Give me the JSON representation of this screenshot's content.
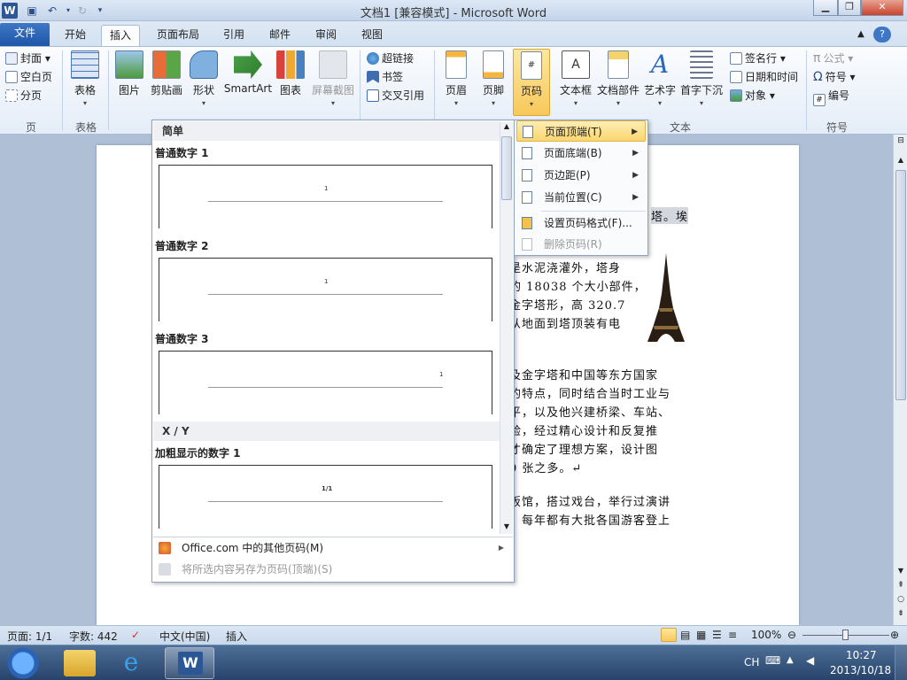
{
  "window": {
    "title": "文档1 [兼容模式] - Microsoft Word"
  },
  "quick_access": {
    "word_icon": "W"
  },
  "menu": {
    "tabs": [
      {
        "label": "文件"
      },
      {
        "label": "开始"
      },
      {
        "label": "插入"
      },
      {
        "label": "页面布局"
      },
      {
        "label": "引用"
      },
      {
        "label": "邮件"
      },
      {
        "label": "审阅"
      },
      {
        "label": "视图"
      }
    ],
    "active_tab": "插入"
  },
  "ribbon": {
    "pages_group": {
      "label": "页",
      "cover": "封面",
      "blank_page": "空白页",
      "page_break": "分页"
    },
    "tables_group": {
      "label": "表格",
      "table": "表格"
    },
    "illustrations": {
      "picture": "图片",
      "clipart": "剪贴画",
      "shapes": "形状",
      "smartart": "SmartArt",
      "chart": "图表",
      "screenshot": "屏幕截图"
    },
    "links_group": {
      "hyperlink": "超链接",
      "bookmark": "书签",
      "cross_reference": "交叉引用"
    },
    "header_footer": {
      "header": "页眉",
      "footer": "页脚",
      "page_number": "页码"
    },
    "text_group": {
      "label": "文本",
      "textbox": "文本框",
      "quick_parts": "文档部件",
      "wordart": "艺术字",
      "dropcap": "首字下沉",
      "signature": "签名行",
      "datetime": "日期和时间",
      "object": "对象"
    },
    "symbols_group": {
      "label": "符号",
      "equation": "公式",
      "symbol": "符号",
      "number": "编号"
    }
  },
  "gallery": {
    "section_simple": "简单",
    "items": [
      {
        "label": "普通数字 1",
        "sample": "1"
      },
      {
        "label": "普通数字 2",
        "sample": "1"
      },
      {
        "label": "普通数字 3",
        "sample": "1"
      }
    ],
    "section_xy": "X / Y",
    "bold_item": {
      "label": "加粗显示的数字 1",
      "sample": "1/1"
    },
    "footer_more": "Office.com 中的其他页码(M)",
    "footer_save": "将所选内容另存为页码(顶端)(S)"
  },
  "submenu": {
    "items": [
      {
        "label": "页面顶端(T)",
        "highlighted": true,
        "has_sub": true
      },
      {
        "label": "页面底端(B)",
        "has_sub": true
      },
      {
        "label": "页边距(P)",
        "has_sub": true
      },
      {
        "label": "当前位置(C)",
        "has_sub": true
      },
      {
        "label": "设置页码格式(F)..."
      },
      {
        "label": "删除页码(R)",
        "disabled": true
      }
    ]
  },
  "document": {
    "lines": [
      "塔。埃",
      "是水泥浇灌外，塔身",
      "的 18038 个大小部件，",
      "金字塔形，高 320.7",
      "从地面到塔顶装有电",
      "及金字塔和中国等东方国家",
      "的特点，同时结合当时工业与",
      "平，以及他兴建桥梁、车站、",
      "验，经过精心设计和反复推",
      "才确定了理想方案，设计图",
      "0 张之多。↵",
      "饭馆，搭过戏台，举行过演讲",
      "。每年都有大批各国游客登上"
    ]
  },
  "statusbar": {
    "page": "页面: 1/1",
    "words": "字数: 442",
    "language": "中文(中国)",
    "mode": "插入",
    "zoom": "100%"
  },
  "taskbar": {
    "ime": "CH",
    "time": "10:27",
    "date": "2013/10/18"
  },
  "colors": {
    "file_tab": "#2a5fb0",
    "highlight": "#fbd66f",
    "taskbar": "#27436b"
  }
}
